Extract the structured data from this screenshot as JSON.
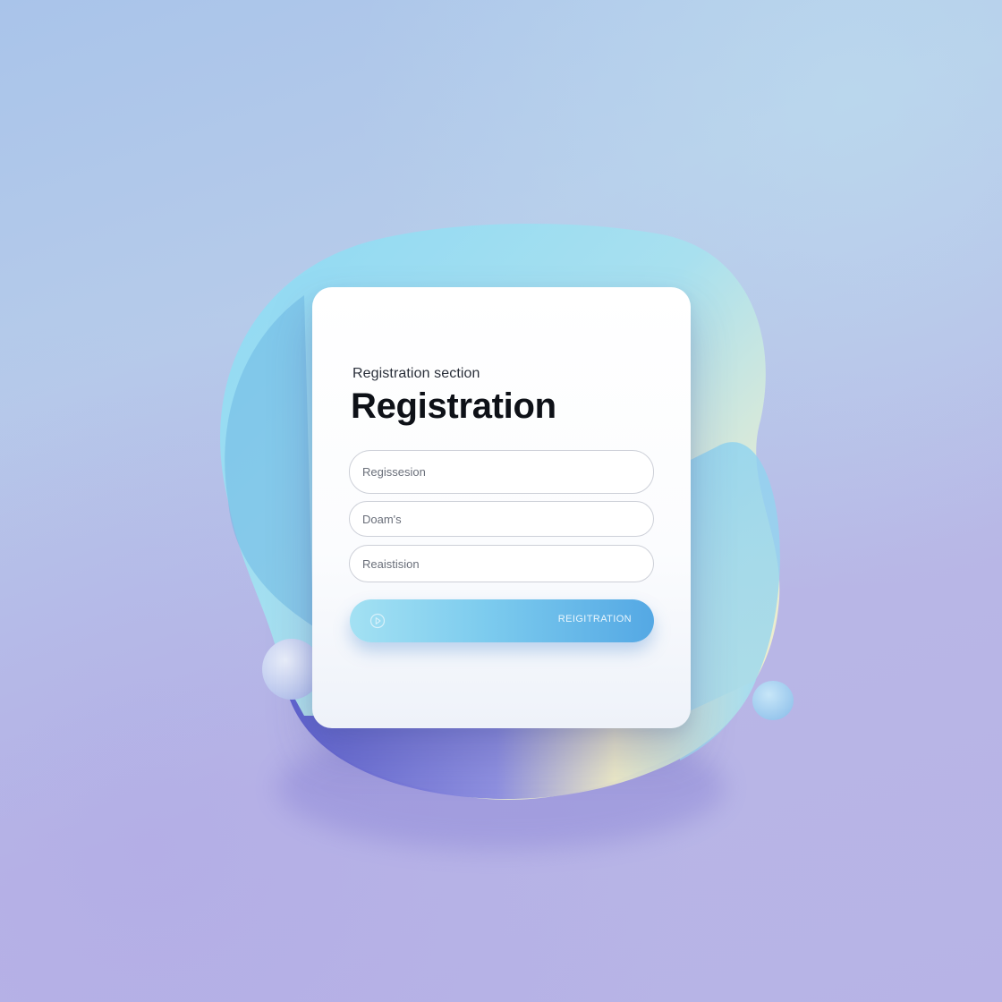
{
  "form": {
    "section_label": "Registration section",
    "title": "Registration",
    "fields": [
      {
        "placeholder": "Regissesion"
      },
      {
        "placeholder": "Doam's"
      },
      {
        "placeholder": "Reaistision"
      }
    ],
    "submit_label": "REIGITRATION",
    "submit_icon": "play-circle-icon"
  },
  "colors": {
    "background_top": "#a9c4ea",
    "background_bottom": "#b7b3e6",
    "blob_blue": "#8ed8f2",
    "blob_yellow": "#f2eec8",
    "blob_indigo": "#5a5fce",
    "button_start": "#a3e1f3",
    "button_end": "#54a8e4",
    "title_text": "#0e1117"
  }
}
